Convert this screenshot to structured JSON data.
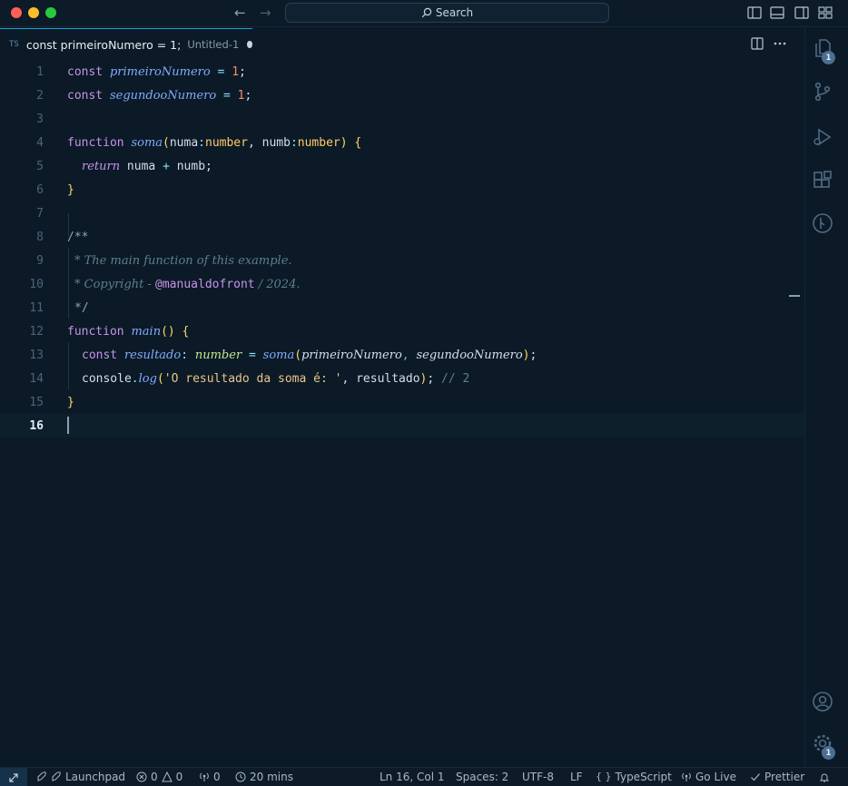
{
  "titlebar": {
    "search_label": "Search",
    "icons": [
      "arrow-left-icon",
      "arrow-right-icon",
      "search-icon",
      "toggle-primary-sidebar-icon",
      "toggle-panel-icon",
      "toggle-secondary-sidebar-icon",
      "customize-layout-icon"
    ]
  },
  "tab": {
    "lang_badge": "TS",
    "title": "const primeiroNumero = 1;",
    "subtitle": "Untitled-1",
    "dirty": true
  },
  "activity_bar": {
    "explorer_badge": "1",
    "settings_badge": "1",
    "icons": [
      "explorer-icon",
      "source-control-icon",
      "run-debug-icon",
      "extensions-icon",
      "git-graph-icon",
      "account-icon",
      "manage-gear-icon"
    ]
  },
  "editor": {
    "cursor_line": 16,
    "lines": [
      {
        "n": "1"
      },
      {
        "n": "2"
      },
      {
        "n": "3"
      },
      {
        "n": "4"
      },
      {
        "n": "5"
      },
      {
        "n": "6"
      },
      {
        "n": "7"
      },
      {
        "n": "8"
      },
      {
        "n": "9"
      },
      {
        "n": "10"
      },
      {
        "n": "11"
      },
      {
        "n": "12"
      },
      {
        "n": "13"
      },
      {
        "n": "14"
      },
      {
        "n": "15"
      },
      {
        "n": "16"
      }
    ],
    "tokens": {
      "l1": [
        "const",
        "primeiroNumero",
        "=",
        "1",
        ";"
      ],
      "l2": [
        "const",
        "segundooNumero",
        "=",
        "1",
        ";"
      ],
      "l4": [
        "function",
        "soma",
        "(",
        "numa",
        ":",
        "number",
        ", ",
        "numb",
        ":",
        "number",
        ")",
        "{"
      ],
      "l5": [
        "return",
        "numa",
        "+",
        "numb",
        ";"
      ],
      "l6": [
        "}"
      ],
      "l8": [
        "/**"
      ],
      "l9": [
        "* The main function of this example."
      ],
      "l10": [
        "* Copyright - ",
        "@manualdofront",
        " / 2024."
      ],
      "l11": [
        "*/"
      ],
      "l12": [
        "function",
        "main",
        "()",
        "{"
      ],
      "l13": [
        "const",
        "resultado",
        ":",
        "number",
        "=",
        "soma",
        "(",
        "primeiroNumero",
        ", ",
        "segundooNumero",
        ")",
        ";"
      ],
      "l14": [
        "console",
        ".",
        "log",
        "(",
        "'O resultado da soma é: '",
        ", ",
        "resultado",
        ")",
        ";",
        "// 2"
      ],
      "l15": [
        "}"
      ]
    }
  },
  "statusbar": {
    "launchpad": "Launchpad",
    "errors": "0",
    "warnings": "0",
    "ports": "0",
    "time": "20 mins",
    "position": "Ln 16, Col 1",
    "spaces": "Spaces: 2",
    "encoding": "UTF-8",
    "eol": "LF",
    "language": "TypeScript",
    "golive": "Go Live",
    "prettier": "Prettier"
  },
  "colors": {
    "background": "#0b1a26",
    "keyword": "#c792ea",
    "function": "#82aaff",
    "number": "#f78c6c",
    "type": "#ffcb6b",
    "string": "#ecc48d",
    "comment": "#5f7e8f",
    "accent": "#18a0d6"
  }
}
